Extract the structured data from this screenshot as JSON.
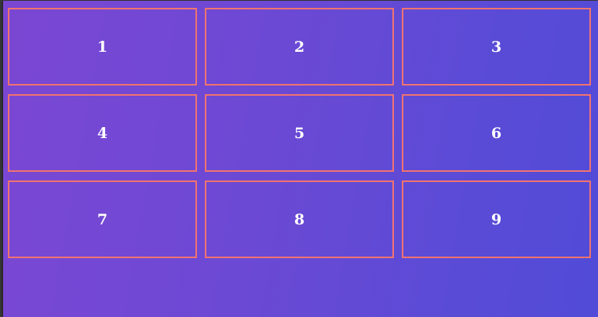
{
  "grid": {
    "cells": [
      "1",
      "2",
      "3",
      "4",
      "5",
      "6",
      "7",
      "8",
      "9"
    ]
  },
  "colors": {
    "gradient_start": "#7b47d3",
    "gradient_end": "#514bd8",
    "cell_border": "#f0736f",
    "cell_text": "#ffffff"
  }
}
